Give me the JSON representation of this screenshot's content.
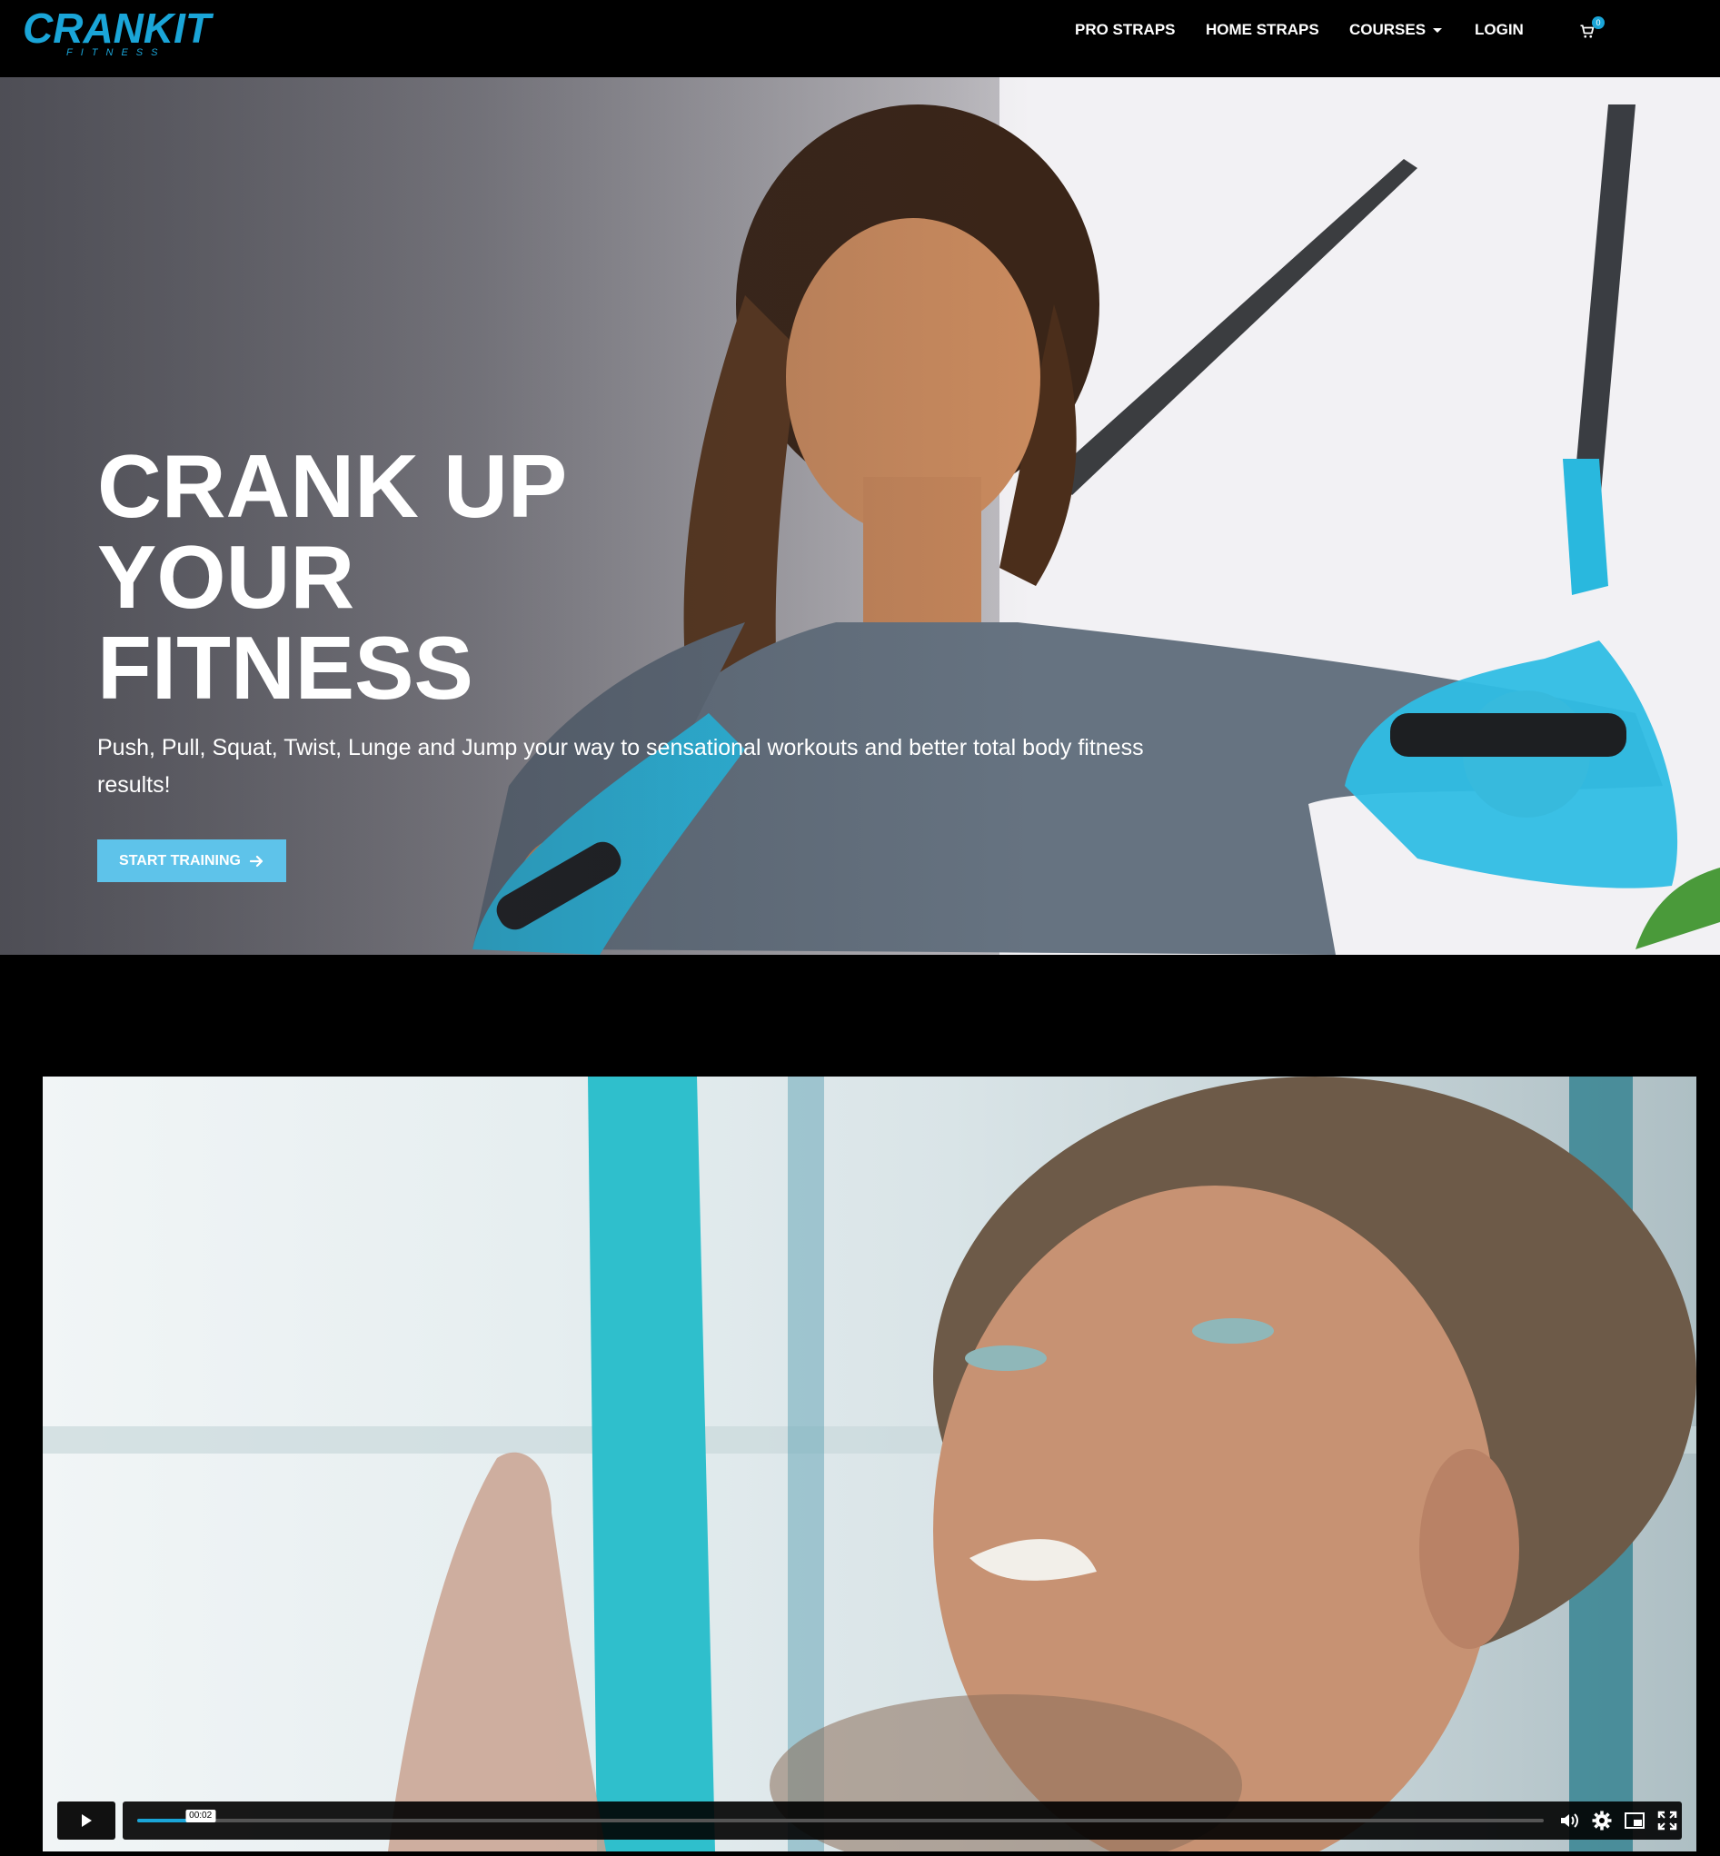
{
  "brand": {
    "name": "CRANKIT",
    "tagline": "FITNESS",
    "color": "#1aa5d8"
  },
  "nav": {
    "items": [
      {
        "label": "PRO STRAPS"
      },
      {
        "label": "HOME STRAPS"
      },
      {
        "label": "COURSES",
        "has_dropdown": true
      },
      {
        "label": "LOGIN"
      }
    ],
    "cart_count": "0"
  },
  "hero": {
    "title": "CRANK UP YOUR FITNESS",
    "subtitle": "Push, Pull, Squat, Twist, Lunge and Jump your way to sensational workouts and better total body fitness results!",
    "cta_label": "START TRAINING",
    "cta_color": "#5ec3ea"
  },
  "video": {
    "current_time": "00:02",
    "progress_fraction": 0.045,
    "icons": [
      "play-icon",
      "volume-icon",
      "settings-icon",
      "pip-icon",
      "fullscreen-icon"
    ]
  }
}
